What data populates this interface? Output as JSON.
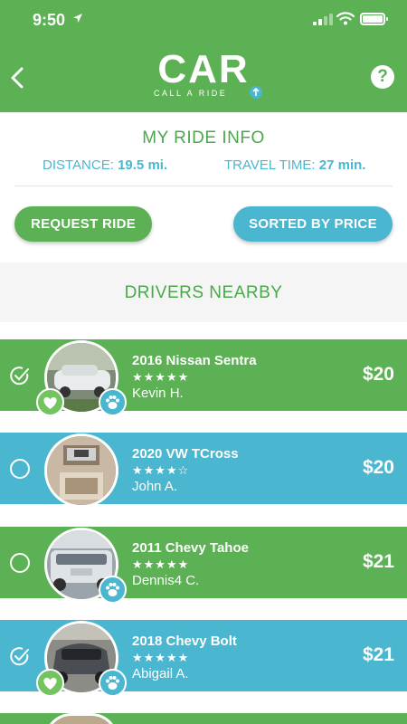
{
  "status_bar": {
    "time": "9:50"
  },
  "header": {
    "logo_word": "CAR",
    "logo_tagline": "CALL A RIDE",
    "help_label": "?"
  },
  "ride_info": {
    "title": "MY RIDE INFO",
    "distance_label": "DISTANCE:",
    "distance_value": "19.5 mi.",
    "travel_label": "TRAVEL TIME:",
    "travel_value": "27 min."
  },
  "buttons": {
    "request": "REQUEST RIDE",
    "sort": "SORTED BY PRICE"
  },
  "nearby_title": "DRIVERS NEARBY",
  "drivers": [
    {
      "car": "2016 Nissan Sentra",
      "stars": "★★★★★",
      "name": "Kevin H.",
      "price": "$20",
      "selected": true,
      "color": "green",
      "heart": true,
      "pet": true
    },
    {
      "car": "2020 VW TCross",
      "stars": "★★★★☆",
      "name": "John A.",
      "price": "$20",
      "selected": false,
      "color": "blue",
      "heart": false,
      "pet": false
    },
    {
      "car": "2011 Chevy Tahoe",
      "stars": "★★★★★",
      "name": "Dennis4 C.",
      "price": "$21",
      "selected": false,
      "color": "green",
      "heart": false,
      "pet": true
    },
    {
      "car": "2018 Chevy Bolt",
      "stars": "★★★★★",
      "name": "Abigail A.",
      "price": "$21",
      "selected": true,
      "color": "blue",
      "heart": true,
      "pet": true
    }
  ],
  "colors": {
    "green": "#5bb153",
    "blue": "#4ab6cf"
  }
}
